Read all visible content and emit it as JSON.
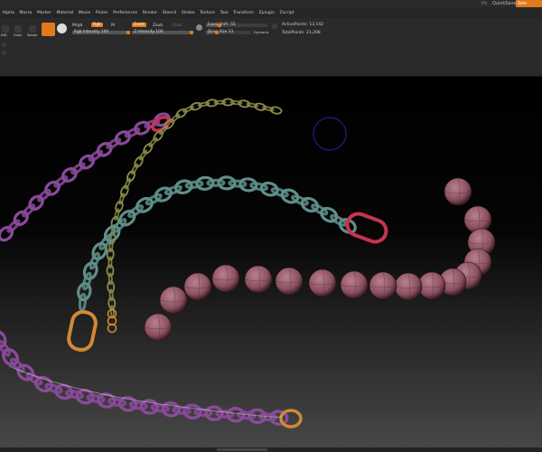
{
  "titlebar": {
    "help_label": "Hc",
    "quicksave_label": "QuickSave",
    "seethrough_label": "See-through"
  },
  "menu": [
    "Alpha",
    "Macro",
    "Marker",
    "Material",
    "Movie",
    "Picker",
    "Preferences",
    "Render",
    "Stencil",
    "Stroke",
    "Texture",
    "Tool",
    "Transform",
    "Zplugin",
    "Zscript"
  ],
  "shelf": {
    "morph_label": "Mrgb",
    "rgb_label": "Rgb",
    "m_label": "M",
    "zadd_label": "Zadd",
    "zsub_label": "Zsub",
    "zcut_label": "Zcut",
    "rgb_intensity_label": "Rgb Intensity",
    "rgb_intensity_value": "100",
    "z_intensity_label": "Z Intensity",
    "z_intensity_value": "100",
    "focal_shift_label": "Focal Shift",
    "focal_shift_value": "-55",
    "draw_size_label": "Draw Size",
    "draw_size_value": "33",
    "dynamic_label": "Dynamic",
    "active_points_label": "ActivePoints:",
    "active_points_value": "13,142",
    "total_points_label": "TotalPoints:",
    "total_points_value": "21,208",
    "left_btn_1": "Edit",
    "left_btn_2": "Draw",
    "left_btn_3": "Rotate"
  },
  "colors": {
    "accent": "#e07a1a",
    "purple_chain": "#8a4a9a",
    "teal_chain": "#5f8f8a",
    "olive_chain": "#8d8c48",
    "red_link": "#c8344e",
    "orange_link": "#cf8a36",
    "beads": "#8a5060",
    "brush_cursor": "#1a1a70"
  },
  "icons": [
    "gear-icon",
    "brush-sphere-icon",
    "material-sphere-icon",
    "scroll-icon"
  ]
}
